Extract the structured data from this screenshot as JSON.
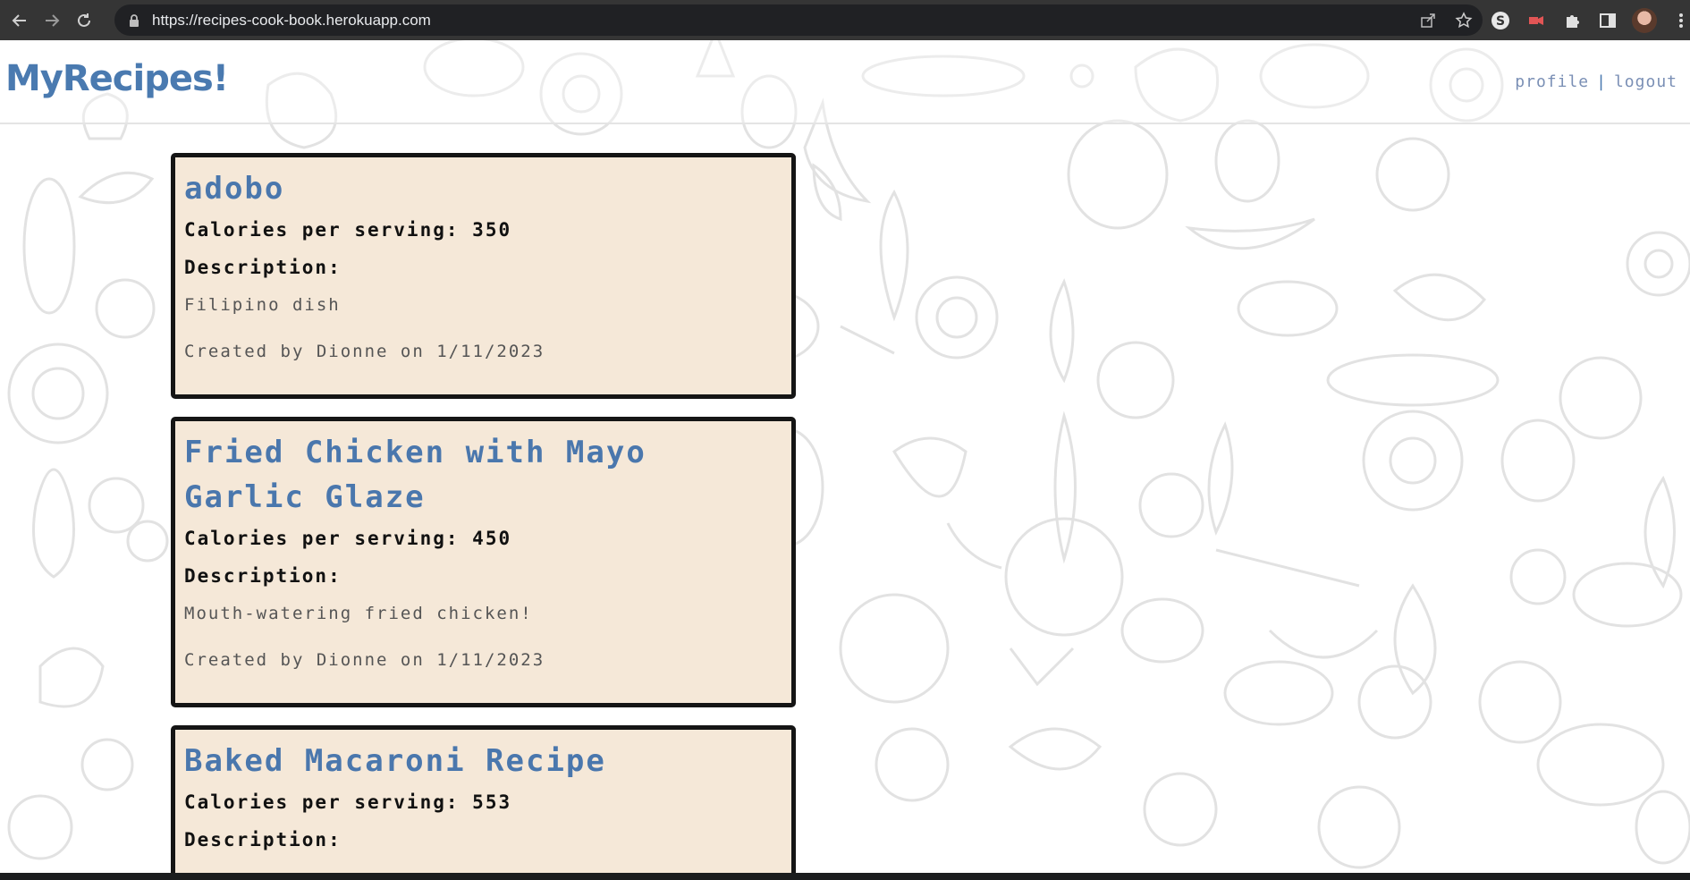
{
  "browser": {
    "url": "https://recipes-cook-book.herokuapp.com",
    "back_icon": "arrow-left-icon",
    "forward_icon": "arrow-right-icon",
    "reload_icon": "reload-icon"
  },
  "header": {
    "logo": "MyRecipes!",
    "nav": {
      "profile": "profile",
      "separator": "|",
      "logout": "logout"
    }
  },
  "recipes": [
    {
      "title": "adobo",
      "calories_label": "Calories per serving:",
      "calories": "350",
      "description_label": "Description:",
      "description": "Filipino dish",
      "created": "Created by Dionne on 1/11/2023"
    },
    {
      "title": "Fried Chicken with Mayo Garlic Glaze",
      "calories_label": "Calories per serving:",
      "calories": "450",
      "description_label": "Description:",
      "description": "Mouth-watering fried chicken!",
      "created": "Created by Dionne on 1/11/2023"
    },
    {
      "title": "Baked Macaroni Recipe",
      "calories_label": "Calories per serving:",
      "calories": "553",
      "description_label": "Description:",
      "description": "",
      "created": ""
    }
  ],
  "colors": {
    "brand": "#4a7ab0",
    "card_bg": "#f5e8d8",
    "card_border": "#151515",
    "chrome": "#353535"
  }
}
